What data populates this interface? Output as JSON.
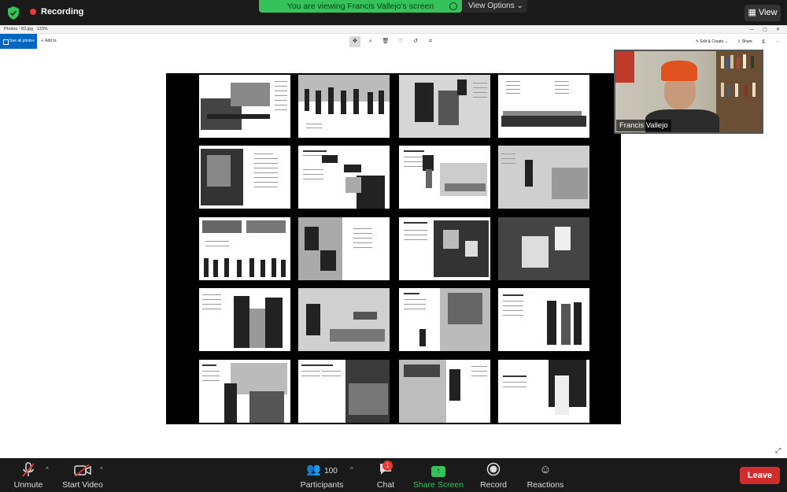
{
  "zoom": {
    "recording_label": "Recording",
    "share_banner": "You are viewing Francis Vallejo's screen",
    "view_options": "View Options",
    "view_button": "View",
    "participant_name": "Francis Vallejo",
    "participants_count": "100",
    "chat_badge": "1",
    "controls": {
      "unmute": "Unmute",
      "start_video": "Start Video",
      "participants": "Participants",
      "chat": "Chat",
      "share_screen": "Share Screen",
      "record": "Record",
      "reactions": "Reactions",
      "leave": "Leave"
    },
    "colors": {
      "share_green": "#35c25a",
      "leave_red": "#d12d2d"
    }
  },
  "photos_app": {
    "window_title": "Photos - 83.jpg",
    "zoom_level": "133%",
    "see_all_photos": "See all photos",
    "add_to": "Add to",
    "edit_create": "Edit & Create",
    "share": "Share",
    "accent": "#0067c0"
  }
}
